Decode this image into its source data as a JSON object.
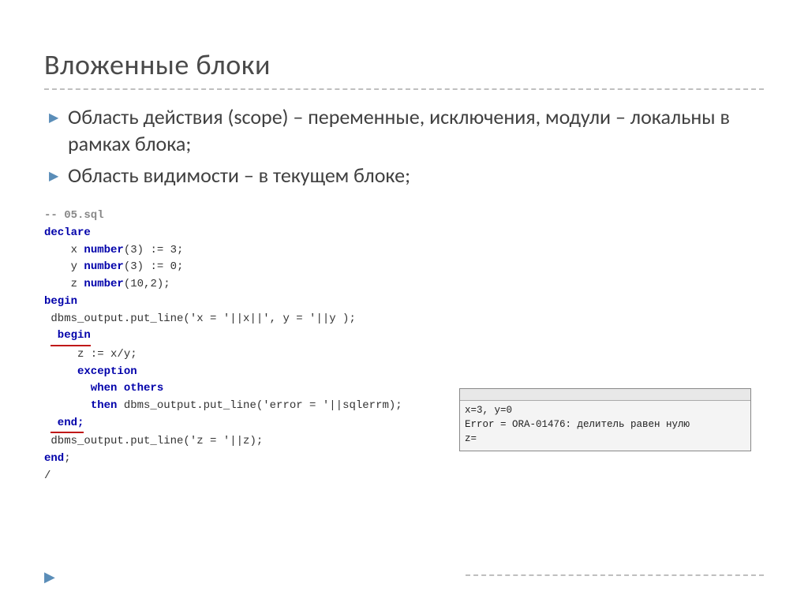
{
  "title": "Вложенные блоки",
  "bullets": [
    "Область действия (scope) – переменные, исключения, модули – локальны в рамках блока;",
    "Область видимости – в текущем блоке;"
  ],
  "code": {
    "l0": "-- 05.sql",
    "l1": "declare",
    "l2a": "    x ",
    "l2b": "number",
    "l2c": "(3) := 3;",
    "l3a": "    y ",
    "l3b": "number",
    "l3c": "(3) := 0;",
    "l4a": "    z ",
    "l4b": "number",
    "l4c": "(10,2);",
    "l5": "begin",
    "l6": " dbms_output.put_line('x = '||x||', y = '||y );",
    "l7": " begin",
    "l8": "     z := x/y;",
    "l9": "     exception",
    "l10": "       when others",
    "l11a": "       ",
    "l11b": "then",
    "l11c": " dbms_output.put_line('error = '||sqlerrm);",
    "l12": " end;",
    "l13": " dbms_output.put_line('z = '||z);",
    "l14": "end",
    "l15": "/"
  },
  "output": {
    "line1": "x=3, y=0",
    "line2": "Error = ORA-01476: делитель равен нулю",
    "line3": "z="
  }
}
